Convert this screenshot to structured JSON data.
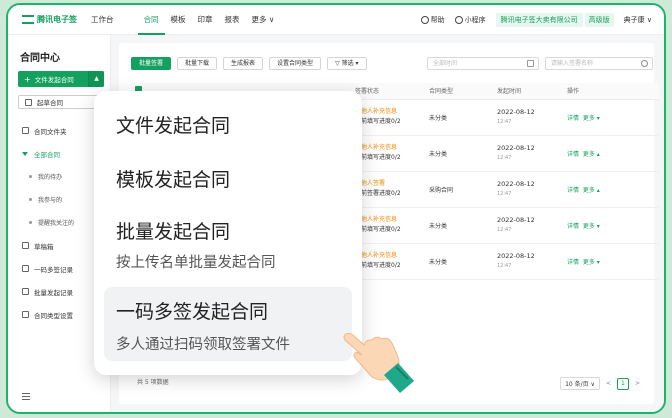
{
  "nav": {
    "logo_text": "腾讯电子签",
    "workbench": "工作台",
    "items": [
      "合同",
      "模板",
      "印章",
      "报表",
      "更多 ∨"
    ],
    "help": "帮助",
    "miniapp": "小程序",
    "company": "腾讯电子签大卖有限公司",
    "edition": "高级版",
    "user": "典子康 ∨"
  },
  "sidebar": {
    "title": "合同中心",
    "start_button": "文件发起合同",
    "draft_button": "起草合同",
    "items": [
      {
        "label": "合同文件夹"
      },
      {
        "label": "全部合同"
      },
      {
        "label": "我的待办"
      },
      {
        "label": "我参与的"
      },
      {
        "label": "提醒我关注的"
      },
      {
        "label": "草稿箱"
      },
      {
        "label": "一码多签记录"
      },
      {
        "label": "批量发起记录"
      },
      {
        "label": "合同类型设置"
      }
    ]
  },
  "toolbar": {
    "buttons": [
      "批量签署",
      "批量下载",
      "生成报表",
      "设置合同类型",
      "筛选"
    ],
    "time_placeholder": "全部时间",
    "name_placeholder": "请输入签署名称"
  },
  "table": {
    "headers": [
      "",
      "",
      "",
      "签署状态",
      "合同类型",
      "发起时间",
      "操作"
    ],
    "rows": [
      {
        "status": "待他人补充信息",
        "progress": "当前填写进度0/2",
        "type": "未分类",
        "date": "2022-08-12",
        "time": "12:47",
        "detail": "详情",
        "more": "更多 ▾"
      },
      {
        "status": "待他人补充信息",
        "progress": "当前填写进度0/2",
        "type": "未分类",
        "date": "2022-08-12",
        "time": "12:47",
        "detail": "详情",
        "more": "更多 ▴"
      },
      {
        "status": "待他人签署",
        "progress": "当前签署进度0/2",
        "type": "采购合同",
        "date": "2022-08-12",
        "time": "12:47",
        "detail": "详情",
        "more": "更多 ▴"
      },
      {
        "status": "待他人补充信息",
        "progress": "当前填写进度0/2",
        "type": "未分类",
        "date": "2022-08-12",
        "time": "12:47",
        "detail": "详情",
        "more": "更多 ▾"
      },
      {
        "status": "待他人补充信息",
        "progress": "当前填写进度0/2",
        "type": "未分类",
        "date": "2022-08-12",
        "time": "12:47",
        "detail": "详情",
        "more": "更多 ▾"
      }
    ]
  },
  "footer": {
    "count": "共 5 项数据",
    "page_size": "10 条/页 ∨",
    "prev": "<",
    "page": "1",
    "next": ">"
  },
  "overlay": {
    "opt1": "文件发起合同",
    "opt2": "模板发起合同",
    "opt3": "批量发起合同",
    "opt3_sub": "按上传名单批量发起合同",
    "opt4": "一码多签发起合同",
    "opt4_sub": "多人通过扫码领取签署文件"
  },
  "colors": {
    "brand": "#14a05e",
    "warning": "#f08a00"
  }
}
